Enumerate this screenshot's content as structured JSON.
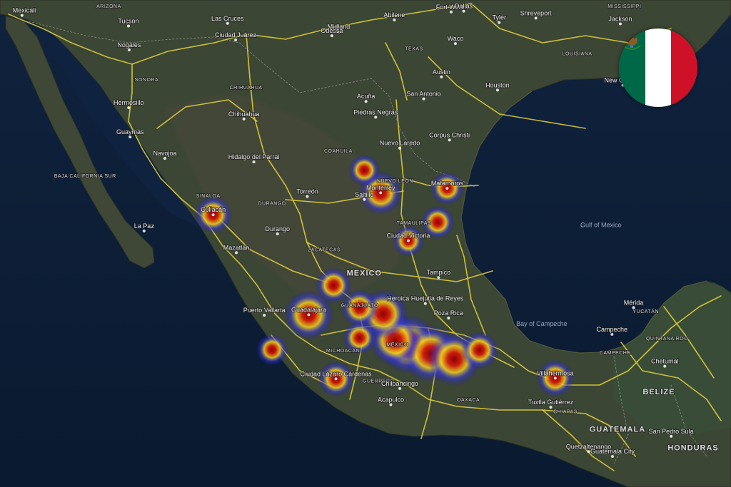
{
  "map": {
    "cities": [
      {
        "name": "Mexicali",
        "lon": -115.47,
        "lat": 32.62
      },
      {
        "name": "Tucson",
        "lon": -110.97,
        "lat": 32.22
      },
      {
        "name": "Las Cruces",
        "lon": -106.78,
        "lat": 32.32
      },
      {
        "name": "Ciudad Juárez",
        "lon": -106.44,
        "lat": 31.69
      },
      {
        "name": "Nogales",
        "lon": -110.94,
        "lat": 31.31
      },
      {
        "name": "Midland",
        "lon": -102.08,
        "lat": 32.0
      },
      {
        "name": "Odessa",
        "lon": -102.37,
        "lat": 31.85
      },
      {
        "name": "Abilene",
        "lon": -99.73,
        "lat": 32.45
      },
      {
        "name": "Fort Worth",
        "lon": -97.33,
        "lat": 32.75
      },
      {
        "name": "Dallas",
        "lon": -96.8,
        "lat": 32.78
      },
      {
        "name": "Tyler",
        "lon": -95.3,
        "lat": 32.35
      },
      {
        "name": "Shreveport",
        "lon": -93.75,
        "lat": 32.52
      },
      {
        "name": "Jackson",
        "lon": -90.18,
        "lat": 32.3
      },
      {
        "name": "Waco",
        "lon": -97.15,
        "lat": 31.55
      },
      {
        "name": "Austin",
        "lon": -97.74,
        "lat": 30.27
      },
      {
        "name": "San Antonio",
        "lon": -98.49,
        "lat": 29.42
      },
      {
        "name": "Houston",
        "lon": -95.37,
        "lat": 29.76
      },
      {
        "name": "New Orleans",
        "lon": -90.07,
        "lat": 29.95
      },
      {
        "name": "Hermosillo",
        "lon": -110.96,
        "lat": 29.07
      },
      {
        "name": "Chihuahua",
        "lon": -106.09,
        "lat": 28.63
      },
      {
        "name": "Acuña",
        "lon": -100.93,
        "lat": 29.32
      },
      {
        "name": "Piedras Negras",
        "lon": -100.52,
        "lat": 28.7
      },
      {
        "name": "Guaymas",
        "lon": -110.9,
        "lat": 27.92
      },
      {
        "name": "Navojoa",
        "lon": -109.43,
        "lat": 27.07
      },
      {
        "name": "Nuevo Laredo",
        "lon": -99.5,
        "lat": 27.48
      },
      {
        "name": "Corpus Christi",
        "lon": -97.4,
        "lat": 27.8
      },
      {
        "name": "Hidalgo del Parral",
        "lon": -105.67,
        "lat": 26.93
      },
      {
        "name": "Matamoros",
        "lon": -97.5,
        "lat": 25.87
      },
      {
        "name": "Monterrey",
        "lon": -100.31,
        "lat": 25.69
      },
      {
        "name": "Saltillo",
        "lon": -101.0,
        "lat": 25.42
      },
      {
        "name": "Torreón",
        "lon": -103.41,
        "lat": 25.54
      },
      {
        "name": "Culiacán",
        "lon": -107.39,
        "lat": 24.8
      },
      {
        "name": "La Paz",
        "lon": -110.31,
        "lat": 24.14
      },
      {
        "name": "Durango",
        "lon": -104.67,
        "lat": 24.02
      },
      {
        "name": "Ciudad Victoria",
        "lon": -99.14,
        "lat": 23.74
      },
      {
        "name": "Mazatlán",
        "lon": -106.41,
        "lat": 23.25
      },
      {
        "name": "Tampico",
        "lon": -97.86,
        "lat": 22.23
      },
      {
        "name": "Heroica Huejutla de Reyes",
        "lon": -98.42,
        "lat": 21.14
      },
      {
        "name": "Poza Rica",
        "lon": -97.44,
        "lat": 20.53
      },
      {
        "name": "Mérida",
        "lon": -89.62,
        "lat": 20.97
      },
      {
        "name": "Campeche",
        "lon": -90.53,
        "lat": 19.85
      },
      {
        "name": "Puerto Vallarta",
        "lon": -105.23,
        "lat": 20.65
      },
      {
        "name": "Guadalajara",
        "lon": -103.35,
        "lat": 20.67
      },
      {
        "name": "Villahermosa",
        "lon": -92.93,
        "lat": 17.99
      },
      {
        "name": "Chetumal",
        "lon": -88.3,
        "lat": 18.5
      },
      {
        "name": "Ciudad Lázaro Cárdenas",
        "lon": -102.2,
        "lat": 17.96
      },
      {
        "name": "Chilpancingo",
        "lon": -99.5,
        "lat": 17.55
      },
      {
        "name": "Acapulco",
        "lon": -99.88,
        "lat": 16.86
      },
      {
        "name": "Tuxtla Gutiérrez",
        "lon": -93.12,
        "lat": 16.75
      },
      {
        "name": "Quetzaltenango",
        "lon": -91.52,
        "lat": 14.84
      },
      {
        "name": "Guatemala City",
        "lon": -90.51,
        "lat": 14.63
      },
      {
        "name": "San Pedro Sula",
        "lon": -88.03,
        "lat": 15.5
      }
    ],
    "states": [
      {
        "name": "ARIZONA",
        "lon": -111.8,
        "lat": 32.9
      },
      {
        "name": "TEXAS",
        "lon": -98.9,
        "lat": 31.3
      },
      {
        "name": "MISSISSIPPI",
        "lon": -90.0,
        "lat": 32.9
      },
      {
        "name": "LOUISIANA",
        "lon": -92.0,
        "lat": 31.1
      },
      {
        "name": "SONORA",
        "lon": -110.2,
        "lat": 30.1
      },
      {
        "name": "CHIHUAHUA",
        "lon": -106.0,
        "lat": 29.8
      },
      {
        "name": "COAHUILA",
        "lon": -102.1,
        "lat": 27.3
      },
      {
        "name": "BAJA CALIFORNIA SUR",
        "lon": -112.8,
        "lat": 26.3
      },
      {
        "name": "SINALOA",
        "lon": -107.6,
        "lat": 25.5
      },
      {
        "name": "DURANGO",
        "lon": -104.9,
        "lat": 25.2
      },
      {
        "name": "NUEVO LEÓN",
        "lon": -99.7,
        "lat": 26.1
      },
      {
        "name": "TAMAULIPAS",
        "lon": -98.9,
        "lat": 24.4
      },
      {
        "name": "ZACATECAS",
        "lon": -102.7,
        "lat": 23.3
      },
      {
        "name": "GUANAJUATO",
        "lon": -101.2,
        "lat": 21.0
      },
      {
        "name": "MICHOACÁN",
        "lon": -101.9,
        "lat": 19.1
      },
      {
        "name": "MÉXICO",
        "lon": -99.6,
        "lat": 19.35
      },
      {
        "name": "GUERRERO",
        "lon": -100.4,
        "lat": 17.8
      },
      {
        "name": "OAXACA",
        "lon": -96.6,
        "lat": 17.0
      },
      {
        "name": "CAMPECHE",
        "lon": -90.4,
        "lat": 19.0
      },
      {
        "name": "YUCATÁN",
        "lon": -89.1,
        "lat": 20.75
      },
      {
        "name": "QUINTANA ROO",
        "lon": -88.2,
        "lat": 19.6
      },
      {
        "name": "CHIAPAS",
        "lon": -92.5,
        "lat": 16.5
      }
    ],
    "countries": [
      {
        "name": "MEXICO",
        "lon": -101.0,
        "lat": 22.3
      },
      {
        "name": "BELIZE",
        "lon": -88.55,
        "lat": 17.3
      },
      {
        "name": "GUATEMALA",
        "lon": -90.3,
        "lat": 15.7
      },
      {
        "name": "HONDURAS",
        "lon": -87.1,
        "lat": 14.9
      }
    ],
    "water": [
      {
        "name": "Gulf of Mexico",
        "lon": -91.0,
        "lat": 24.3
      },
      {
        "name": "Bay of Campeche",
        "lon": -93.5,
        "lat": 20.2
      }
    ],
    "hotspots": [
      {
        "lon": -99.13,
        "lat": 19.43,
        "weight": 1.0
      },
      {
        "lon": -98.2,
        "lat": 19.04,
        "weight": 0.95
      },
      {
        "lon": -97.2,
        "lat": 18.8,
        "weight": 0.85
      },
      {
        "lon": -99.7,
        "lat": 19.6,
        "weight": 0.8
      },
      {
        "lon": -100.2,
        "lat": 20.7,
        "weight": 0.75
      },
      {
        "lon": -103.35,
        "lat": 20.67,
        "weight": 0.75
      },
      {
        "lon": -100.31,
        "lat": 25.69,
        "weight": 0.6
      },
      {
        "lon": -107.39,
        "lat": 24.8,
        "weight": 0.45
      },
      {
        "lon": -92.93,
        "lat": 17.99,
        "weight": 0.45
      },
      {
        "lon": -96.13,
        "lat": 19.18,
        "weight": 0.45
      },
      {
        "lon": -102.3,
        "lat": 21.9,
        "weight": 0.4
      },
      {
        "lon": -101.2,
        "lat": 20.95,
        "weight": 0.45
      },
      {
        "lon": -102.2,
        "lat": 17.96,
        "weight": 0.4
      },
      {
        "lon": -97.5,
        "lat": 25.87,
        "weight": 0.35
      },
      {
        "lon": -97.9,
        "lat": 24.5,
        "weight": 0.35
      },
      {
        "lon": -99.14,
        "lat": 23.74,
        "weight": 0.3
      },
      {
        "lon": -101.0,
        "lat": 26.6,
        "weight": 0.3
      },
      {
        "lon": -101.2,
        "lat": 19.7,
        "weight": 0.35
      },
      {
        "lon": -104.9,
        "lat": 19.2,
        "weight": 0.3
      }
    ]
  },
  "flag": {
    "colors": {
      "green": "#006847",
      "white": "#ffffff",
      "red": "#ce1126"
    }
  }
}
